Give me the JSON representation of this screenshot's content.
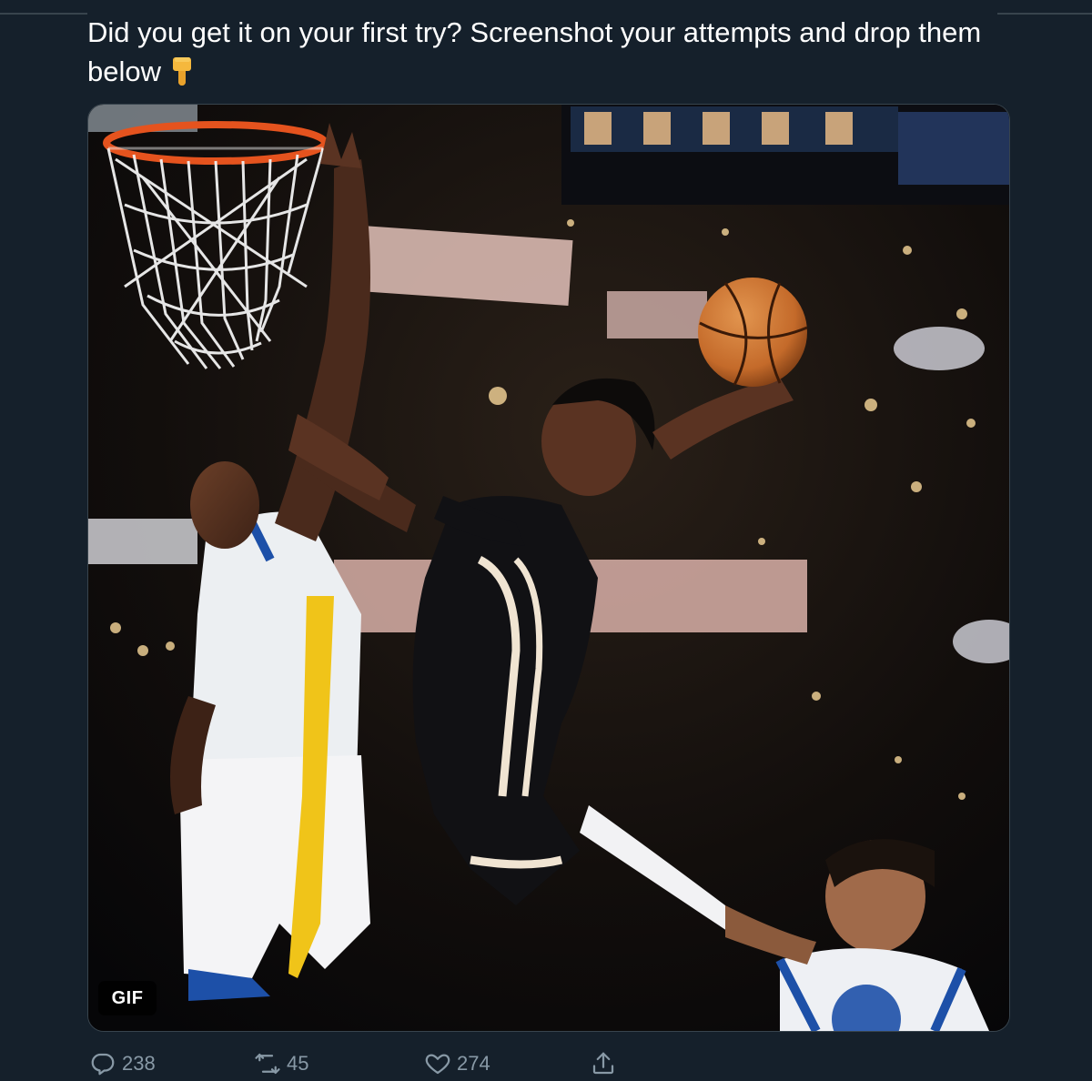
{
  "tweet": {
    "text": "Did you get it on your first try? Screenshot your attempts and drop them below",
    "emoji": "backhand-index-pointing-down"
  },
  "media": {
    "badge": "GIF",
    "description_icon": "basketball-dunk-photo"
  },
  "actions": {
    "replies": "238",
    "retweets": "45",
    "likes": "274"
  },
  "colors": {
    "background": "#15202b",
    "text": "#ffffff",
    "muted": "#8899a6",
    "border": "#38444d"
  }
}
